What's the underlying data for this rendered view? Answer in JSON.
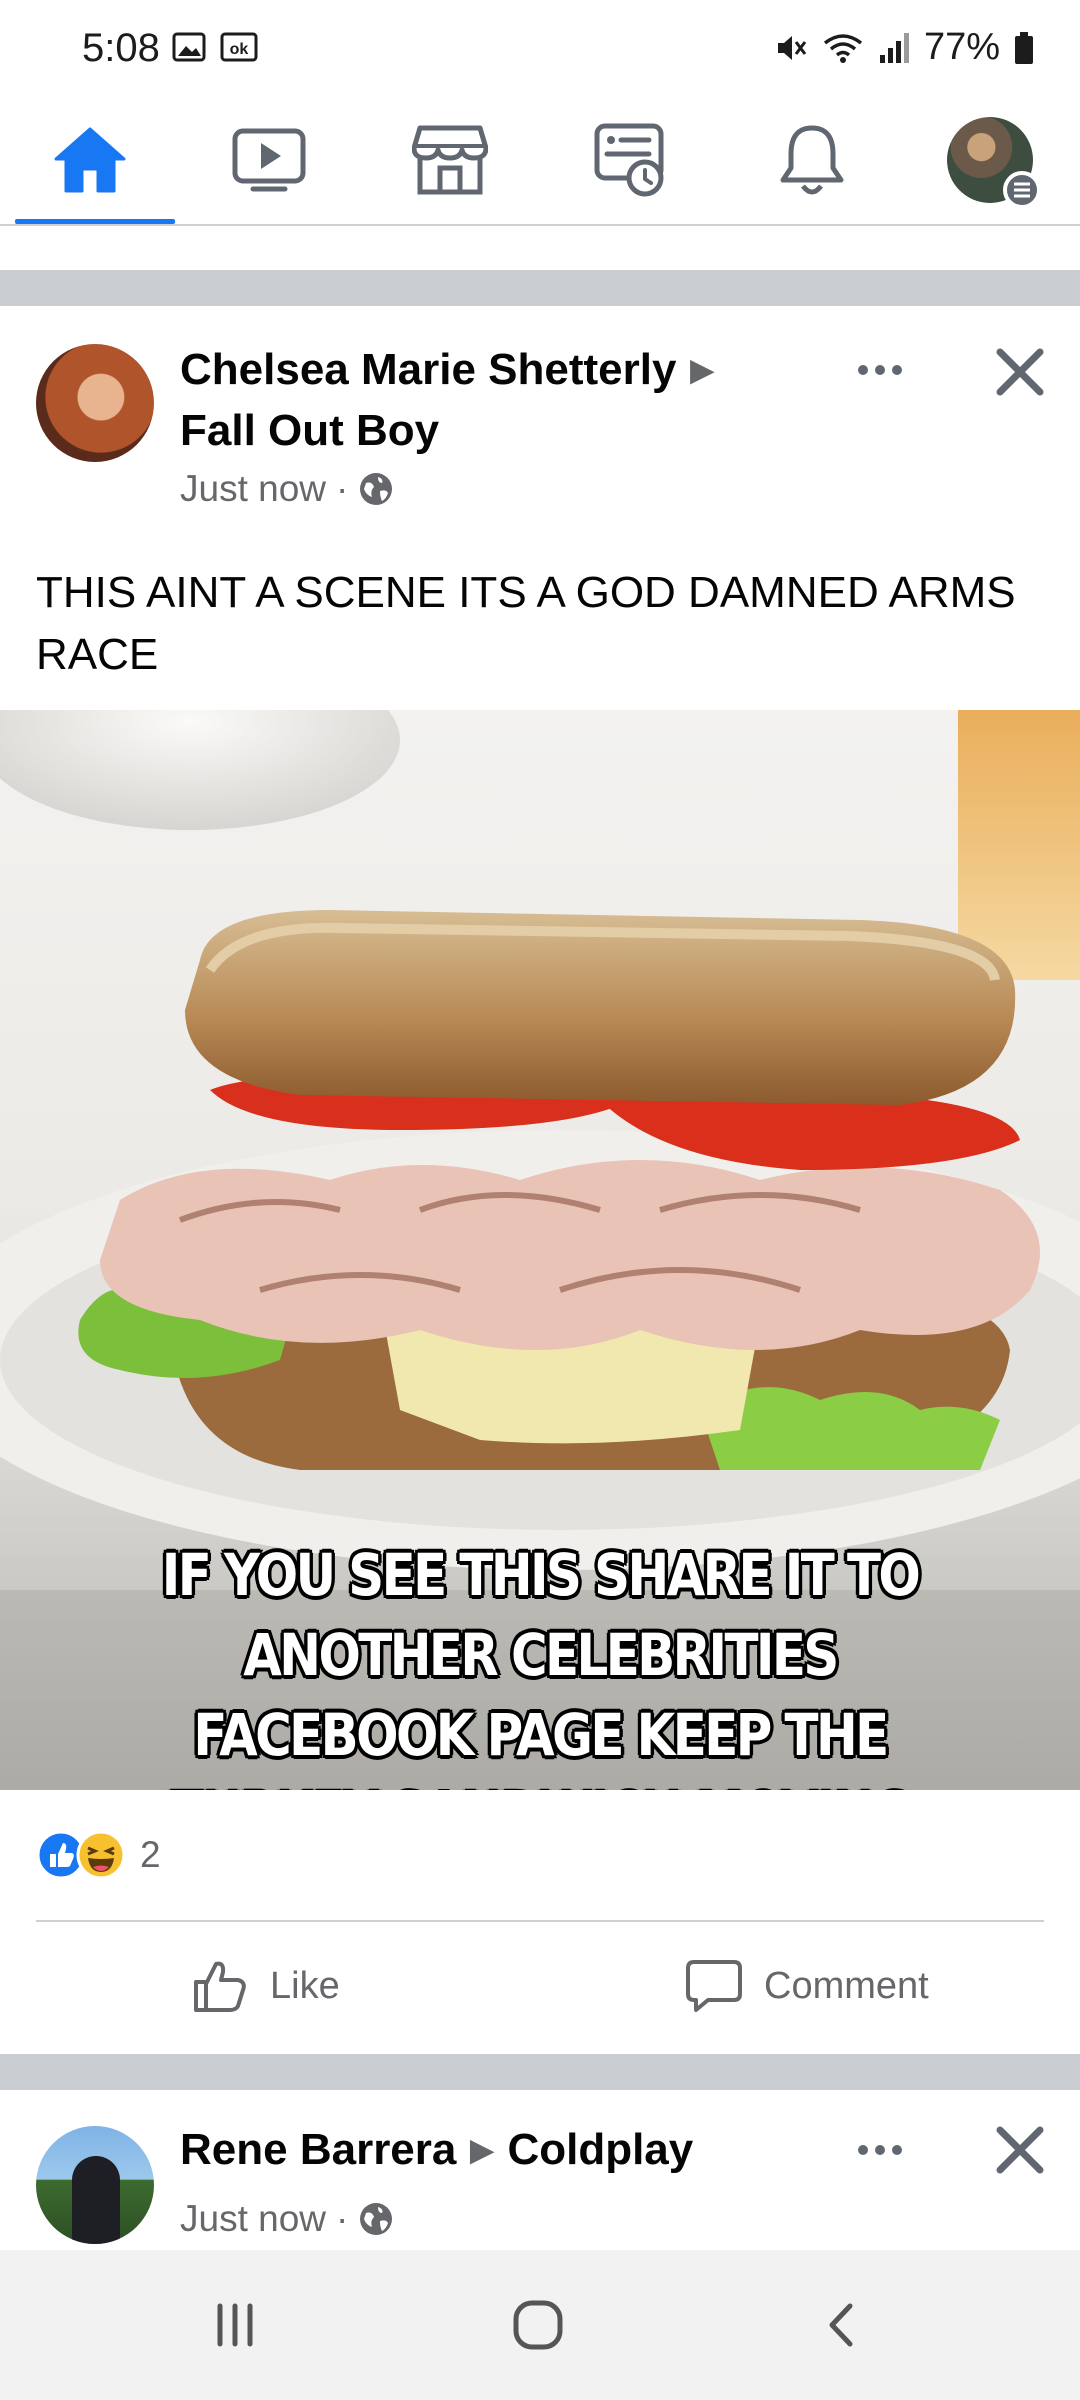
{
  "status_bar": {
    "time": "5:08",
    "battery": "77%"
  },
  "nav": {
    "items": [
      "home-icon",
      "watch-icon",
      "marketplace-icon",
      "memories-icon",
      "notifications-icon",
      "profile-menu"
    ],
    "active": "home",
    "accent_color": "#1877f2"
  },
  "post": {
    "author": "Chelsea Marie Shetterly",
    "target": "Fall Out Boy",
    "time": "Just now",
    "text": "THIS AINT A SCENE ITS A GOD DAMNED ARMS RACE",
    "image_caption": "IF YOU SEE THIS SHARE IT TO ANOTHER CELEBRITIES FACEBOOK PAGE KEEP THE TURKEY SANDWICH MOVING",
    "reaction_count": "2",
    "like_label": "Like",
    "comment_label": "Comment"
  },
  "post2": {
    "author": "Rene Barrera",
    "target": "Coldplay",
    "time": "Just now"
  }
}
